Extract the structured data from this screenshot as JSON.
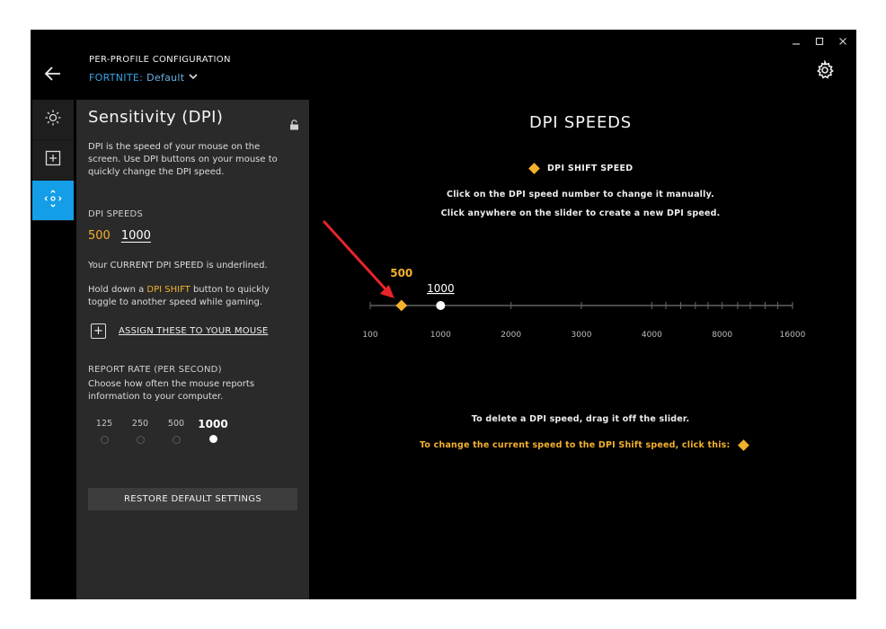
{
  "header": {
    "caption": "PER-PROFILE CONFIGURATION",
    "game": "FORTNITE:",
    "profile": "Default"
  },
  "panel": {
    "title": "Sensitivity (DPI)",
    "description": "DPI is the speed of your mouse on the screen. Use DPI buttons on your mouse to quickly change the DPI speed.",
    "dpi_speeds_label": "DPI SPEEDS",
    "dpi_values": [
      "500",
      "1000"
    ],
    "current_note": "Your CURRENT DPI SPEED is underlined.",
    "shift_note_before": "Hold down a ",
    "shift_note_highlight": "DPI SHIFT",
    "shift_note_after": " button to quickly toggle to another speed while gaming.",
    "assign_label": "ASSIGN THESE TO YOUR MOUSE",
    "report_rate_label": "REPORT RATE (PER SECOND)",
    "report_rate_desc": "Choose how often the mouse reports information to your computer.",
    "report_rates": [
      "125",
      "250",
      "500",
      "1000"
    ],
    "report_rate_selected": "1000",
    "restore_label": "RESTORE DEFAULT SETTINGS"
  },
  "main": {
    "title": "DPI SPEEDS",
    "shift_legend": "DPI SHIFT SPEED",
    "instruction_1": "Click on the DPI speed number to change it manually.",
    "instruction_2": "Click anywhere on the slider to create a new DPI speed.",
    "delete_hint": "To delete a DPI speed, drag it off the slider.",
    "shift_hint": "To change the current speed to the DPI Shift speed, click this:"
  },
  "slider": {
    "tick_labels": [
      "100",
      "1000",
      "2000",
      "3000",
      "4000",
      "8000",
      "16000"
    ],
    "label_fractions": [
      0,
      0.1667,
      0.3333,
      0.5,
      0.6667,
      0.8333,
      1.0
    ],
    "points": [
      {
        "label": "500",
        "fraction": 0.074,
        "kind": "shift"
      },
      {
        "label": "1000",
        "fraction": 0.1667,
        "kind": "current"
      }
    ]
  },
  "colors": {
    "accent_blue": "#139ee7",
    "shift_orange": "#f3b12c",
    "window_bg": "#000000",
    "panel_bg": "#2a2a2a"
  },
  "icons": {
    "back": "arrow-left-icon",
    "settings": "gear-icon",
    "nav": [
      "brightness-icon",
      "plus-square-icon",
      "move-arrows-icon"
    ],
    "lock": "unlock-icon"
  }
}
